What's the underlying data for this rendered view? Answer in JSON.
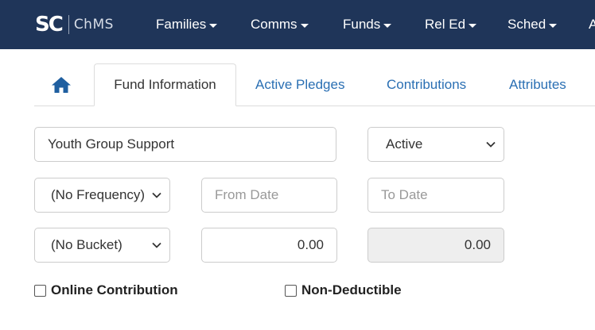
{
  "app": {
    "logo_mark": "SC",
    "logo_text": "ChMS"
  },
  "nav": {
    "items": [
      {
        "label": "Families"
      },
      {
        "label": "Comms"
      },
      {
        "label": "Funds"
      },
      {
        "label": "Rel Ed"
      },
      {
        "label": "Sched"
      },
      {
        "label": "A"
      }
    ]
  },
  "tabs": {
    "home_icon": "home-icon",
    "items": [
      {
        "label": "Fund Information",
        "active": true
      },
      {
        "label": "Active Pledges",
        "active": false
      },
      {
        "label": "Contributions",
        "active": false
      },
      {
        "label": "Attributes",
        "active": false
      }
    ]
  },
  "form": {
    "fund_name": "Youth Group Support",
    "status": "Active",
    "frequency": "(No Frequency)",
    "from_date_placeholder": "From Date",
    "to_date_placeholder": "To Date",
    "bucket": "(No Bucket)",
    "amount": "0.00",
    "total": "0.00",
    "online_contribution_label": "Online Contribution",
    "online_contribution_checked": false,
    "non_deductible_label": "Non-Deductible",
    "non_deductible_checked": false
  },
  "colors": {
    "navbar": "#1f3559",
    "link": "#2a6fb3",
    "home_icon": "#1f5fa0"
  }
}
